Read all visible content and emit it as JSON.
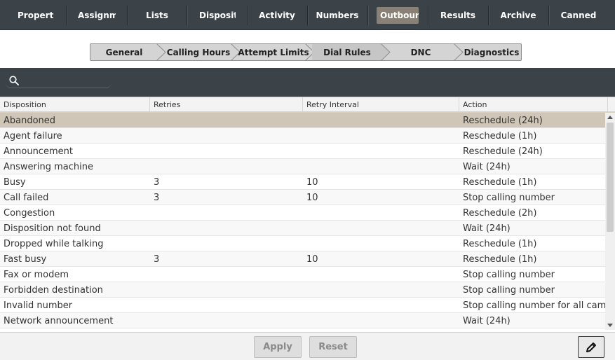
{
  "top_tabs": [
    {
      "label": "Properties",
      "active": false
    },
    {
      "label": "Assignments",
      "active": false
    },
    {
      "label": "Lists",
      "active": false
    },
    {
      "label": "Dispositions",
      "active": false
    },
    {
      "label": "Activity",
      "active": false
    },
    {
      "label": "Numbers",
      "active": false
    },
    {
      "label": "Outbound",
      "active": true
    },
    {
      "label": "Results",
      "active": false
    },
    {
      "label": "Archive",
      "active": false
    },
    {
      "label": "Canned",
      "active": false
    }
  ],
  "sub_tabs": [
    {
      "label": "General",
      "active": false
    },
    {
      "label": "Calling Hours",
      "active": false
    },
    {
      "label": "Attempt Limits",
      "active": false
    },
    {
      "label": "Dial Rules",
      "active": true
    },
    {
      "label": "DNC",
      "active": false
    },
    {
      "label": "Diagnostics",
      "active": false
    }
  ],
  "search": {
    "value": "",
    "placeholder": ""
  },
  "table": {
    "columns": [
      "Disposition",
      "Retries",
      "Retry Interval",
      "Action"
    ],
    "rows": [
      [
        "Abandoned",
        "",
        "",
        "Reschedule (24h)"
      ],
      [
        "Agent failure",
        "",
        "",
        "Reschedule (1h)"
      ],
      [
        "Announcement",
        "",
        "",
        "Reschedule (24h)"
      ],
      [
        "Answering machine",
        "",
        "",
        "Wait (24h)"
      ],
      [
        "Busy",
        "3",
        "10",
        "Reschedule (1h)"
      ],
      [
        "Call failed",
        "3",
        "10",
        "Stop calling number"
      ],
      [
        "Congestion",
        "",
        "",
        "Reschedule (2h)"
      ],
      [
        "Disposition not found",
        "",
        "",
        "Wait (24h)"
      ],
      [
        "Dropped while talking",
        "",
        "",
        "Reschedule (1h)"
      ],
      [
        "Fast busy",
        "3",
        "10",
        "Reschedule (1h)"
      ],
      [
        "Fax or modem",
        "",
        "",
        "Stop calling number"
      ],
      [
        "Forbidden destination",
        "",
        "",
        "Stop calling number"
      ],
      [
        "Invalid number",
        "",
        "",
        "Stop calling number for all campaigns"
      ],
      [
        "Network announcement",
        "",
        "",
        "Wait (24h)"
      ]
    ],
    "selected_row": 0
  },
  "footer": {
    "apply_label": "Apply",
    "reset_label": "Reset",
    "edit_icon": "pencil-icon"
  },
  "colors": {
    "accent": "#8a8176",
    "toolbar": "#3b4248",
    "selected_row": "#cfc6b8"
  }
}
